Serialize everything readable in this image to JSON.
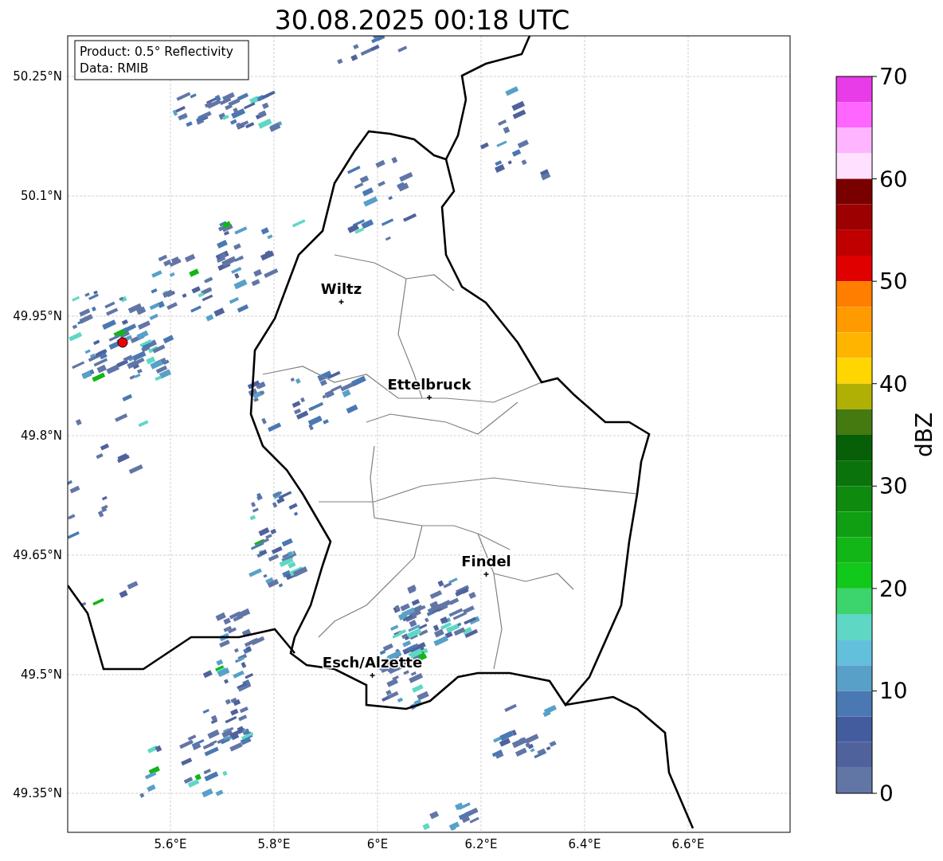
{
  "title": "30.08.2025 00:18 UTC",
  "info_box": {
    "lines": [
      "Product: 0.5° Reflectivity",
      "Data: RMIB"
    ]
  },
  "x_ticks": [
    "5.6°E",
    "5.8°E",
    "6°E",
    "6.2°E",
    "6.4°E",
    "6.6°E"
  ],
  "y_ticks": [
    "50.25°N",
    "50.1°N",
    "49.95°N",
    "49.8°N",
    "49.65°N",
    "49.5°N",
    "49.35°N"
  ],
  "cities": [
    {
      "name": "Wiltz"
    },
    {
      "name": "Ettelbruck"
    },
    {
      "name": "Findel"
    },
    {
      "name": "Esch/Alzette"
    }
  ],
  "colorbar": {
    "label": "dBZ",
    "ticks": [
      "70",
      "60",
      "50",
      "40",
      "30",
      "20",
      "10",
      "0"
    ],
    "segments": [
      {
        "color": "#e83ce8"
      },
      {
        "color": "#ff66ff"
      },
      {
        "color": "#ffb4ff"
      },
      {
        "color": "#ffe0ff"
      },
      {
        "color": "#7a0000"
      },
      {
        "color": "#9c0000"
      },
      {
        "color": "#c00000"
      },
      {
        "color": "#e00000"
      },
      {
        "color": "#ff7e00"
      },
      {
        "color": "#ff9a00"
      },
      {
        "color": "#ffb400"
      },
      {
        "color": "#ffd600"
      },
      {
        "color": "#b0b004"
      },
      {
        "color": "#457a10"
      },
      {
        "color": "#075f08"
      },
      {
        "color": "#0b730b"
      },
      {
        "color": "#0e8a0e"
      },
      {
        "color": "#109e12"
      },
      {
        "color": "#12b616"
      },
      {
        "color": "#12c81a"
      },
      {
        "color": "#3cd46c"
      },
      {
        "color": "#5ed8c4"
      },
      {
        "color": "#62c0dc"
      },
      {
        "color": "#58a0c8"
      },
      {
        "color": "#4a78b2"
      },
      {
        "color": "#425c9e"
      },
      {
        "color": "#50629c"
      },
      {
        "color": "#6276a6"
      }
    ]
  }
}
